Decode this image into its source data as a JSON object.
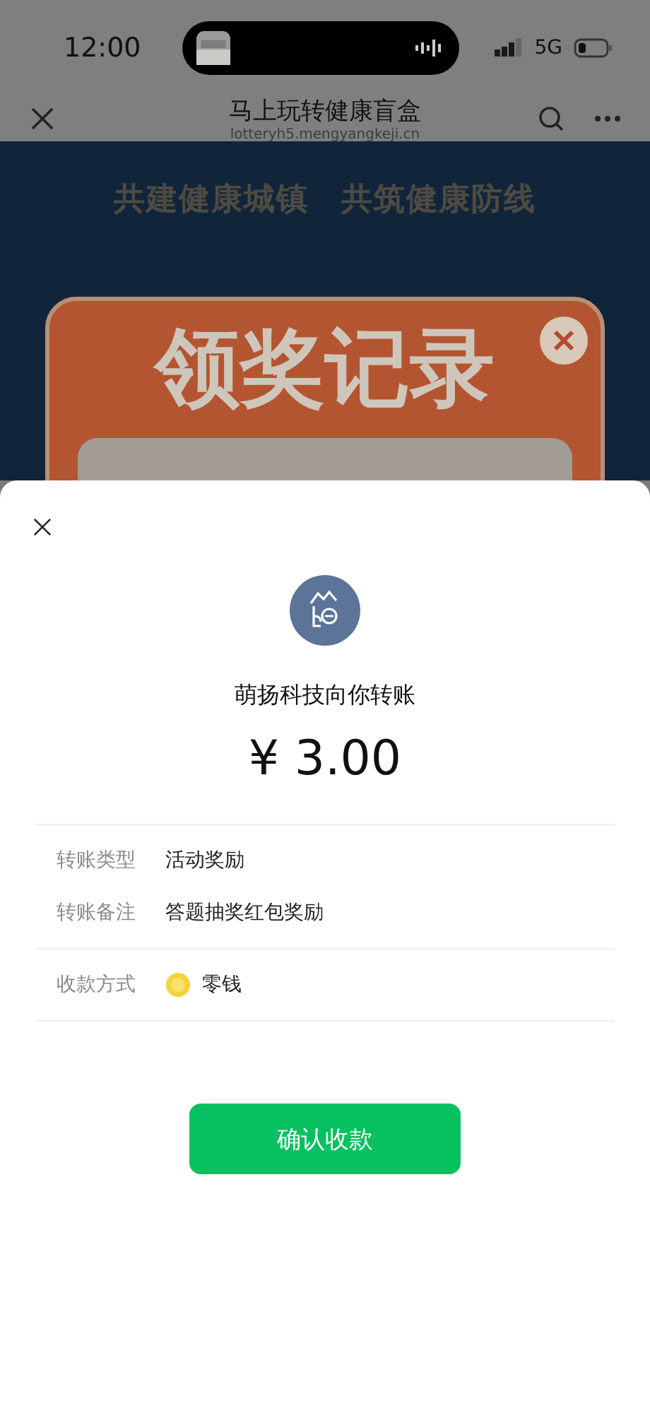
{
  "status_bar": {
    "time": "12:00",
    "network": "5G"
  },
  "nav": {
    "title": "马上玩转健康盲盒",
    "subtitle": "lotteryh5.mengyangkeji.cn"
  },
  "background_page": {
    "slogan": "共建健康城镇　共筑健康防线",
    "popup_title": "领奖记录"
  },
  "sheet": {
    "sender": "萌扬科技向你转账",
    "amount": "¥ 3.00",
    "details": [
      {
        "label": "转账类型",
        "value": "活动奖励",
        "kind": "text"
      },
      {
        "label": "转账备注",
        "value": "答题抽奖红包奖励",
        "kind": "text"
      },
      {
        "label": "收款方式",
        "value": "零钱",
        "kind": "coin"
      }
    ],
    "confirm_button": "确认收款"
  }
}
